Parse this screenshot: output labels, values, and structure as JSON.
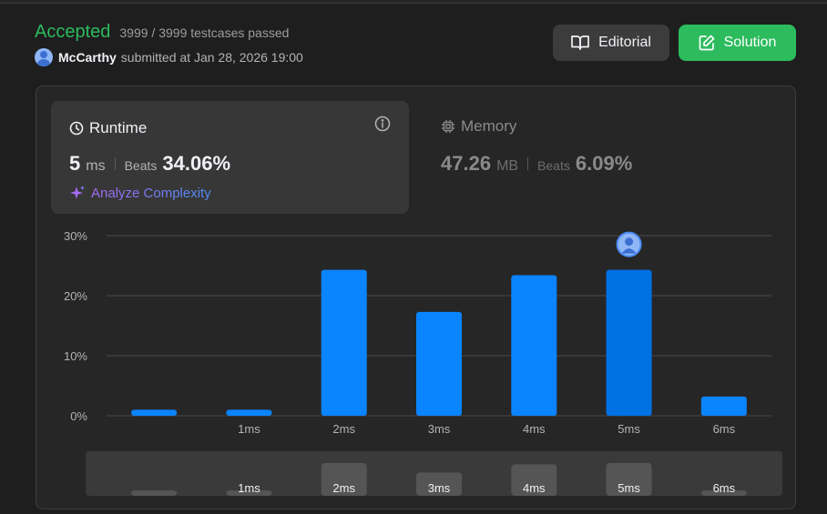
{
  "submission": {
    "status": "Accepted",
    "testcases": "3999 / 3999 testcases passed",
    "user": "McCarthy",
    "submitted": "submitted at Jan 28, 2026 19:00"
  },
  "buttons": {
    "editorial": "Editorial",
    "solution": "Solution"
  },
  "runtime": {
    "title": "Runtime",
    "value": "5",
    "unit": "ms",
    "beats_label": "Beats",
    "beats": "34.06%",
    "analyze": "Analyze Complexity"
  },
  "memory": {
    "title": "Memory",
    "value": "47.26",
    "unit": "MB",
    "beats_label": "Beats",
    "beats": "6.09%"
  },
  "colors": {
    "accepted": "#2cbb5d",
    "bar": "#0a84ff",
    "bar_selected": "#0071e3"
  },
  "chart_data": {
    "type": "bar",
    "categories": [
      "",
      "1ms",
      "2ms",
      "3ms",
      "4ms",
      "5ms",
      "6ms"
    ],
    "values": [
      1.0,
      1.0,
      24.3,
      17.3,
      23.4,
      24.3,
      3.2
    ],
    "y_ticks": [
      "0%",
      "10%",
      "20%",
      "30%"
    ],
    "ylim": [
      0,
      30
    ],
    "selected_category": "5ms",
    "grid": true
  }
}
